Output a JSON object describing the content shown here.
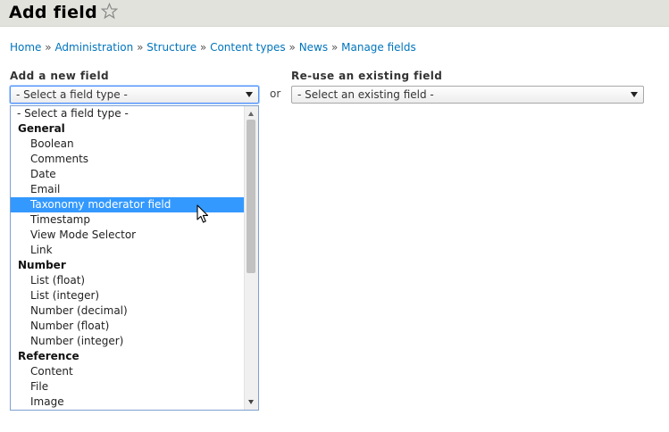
{
  "header": {
    "title": "Add field"
  },
  "breadcrumb": {
    "items": [
      "Home",
      "Administration",
      "Structure",
      "Content types",
      "News",
      "Manage fields"
    ],
    "separator": "»"
  },
  "new_field": {
    "label": "Add a new field",
    "selected": "- Select a field type -"
  },
  "or_text": "or",
  "existing_field": {
    "label": "Re-use an existing field",
    "selected": "- Select an existing field -"
  },
  "dropdown": {
    "options": [
      {
        "text": "- Select a field type -",
        "kind": "placeholder"
      },
      {
        "text": "General",
        "kind": "group"
      },
      {
        "text": "Boolean",
        "kind": "option"
      },
      {
        "text": "Comments",
        "kind": "option"
      },
      {
        "text": "Date",
        "kind": "option"
      },
      {
        "text": "Email",
        "kind": "option"
      },
      {
        "text": "Taxonomy moderator field",
        "kind": "option",
        "highlighted": true
      },
      {
        "text": "Timestamp",
        "kind": "option"
      },
      {
        "text": "View Mode Selector",
        "kind": "option"
      },
      {
        "text": "Link",
        "kind": "option"
      },
      {
        "text": "Number",
        "kind": "group"
      },
      {
        "text": "List (float)",
        "kind": "option"
      },
      {
        "text": "List (integer)",
        "kind": "option"
      },
      {
        "text": "Number (decimal)",
        "kind": "option"
      },
      {
        "text": "Number (float)",
        "kind": "option"
      },
      {
        "text": "Number (integer)",
        "kind": "option"
      },
      {
        "text": "Reference",
        "kind": "group"
      },
      {
        "text": "Content",
        "kind": "option"
      },
      {
        "text": "File",
        "kind": "option"
      },
      {
        "text": "Image",
        "kind": "option"
      }
    ]
  },
  "colors": {
    "link": "#0074bd",
    "highlight": "#3399ff",
    "header_bg": "#e1e2dc"
  },
  "icons": {
    "favorite": "star-outline-icon",
    "pointer": "mouse-cursor-icon"
  }
}
